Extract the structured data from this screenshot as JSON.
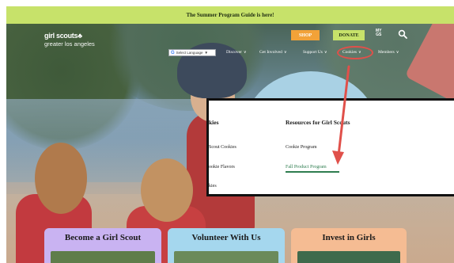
{
  "announcement": {
    "text": "The Summer Program Guide is here!"
  },
  "brand": {
    "logo_line1": "girl scouts",
    "logo_line2": "greater los angeles"
  },
  "header": {
    "shop_label": "SHOP",
    "donate_label": "DONATE",
    "my_gs_line1": "MY",
    "my_gs_line2": "GS",
    "search_icon": "search-icon"
  },
  "nav": {
    "language_select": "Select Language",
    "items": [
      {
        "label": "Discover"
      },
      {
        "label": "Get Involved"
      },
      {
        "label": "Support Us"
      },
      {
        "label": "Cookies"
      },
      {
        "label": "Members"
      }
    ]
  },
  "dropdown": {
    "col1_title": "kies",
    "col1_links": [
      "Scout Cookies",
      "ookie Flavors",
      "kies"
    ],
    "col2_title": "Resources for Girl Scouts",
    "col2_links": [
      "Cookie Program",
      "Fall Product Program"
    ]
  },
  "cards": [
    {
      "title": "Become a Girl Scout"
    },
    {
      "title": "Volunteer With Us"
    },
    {
      "title": "Invest in Girls"
    }
  ],
  "colors": {
    "announcement_bg": "#c7e26a",
    "shop_bg": "#f2a238",
    "donate_bg": "#c7e26a",
    "highlight_red": "#e0504a",
    "link_underline": "#2e7d4f",
    "card_purple": "#c9b3f2",
    "card_blue": "#a5d7ee",
    "card_peach": "#f5bc93"
  }
}
